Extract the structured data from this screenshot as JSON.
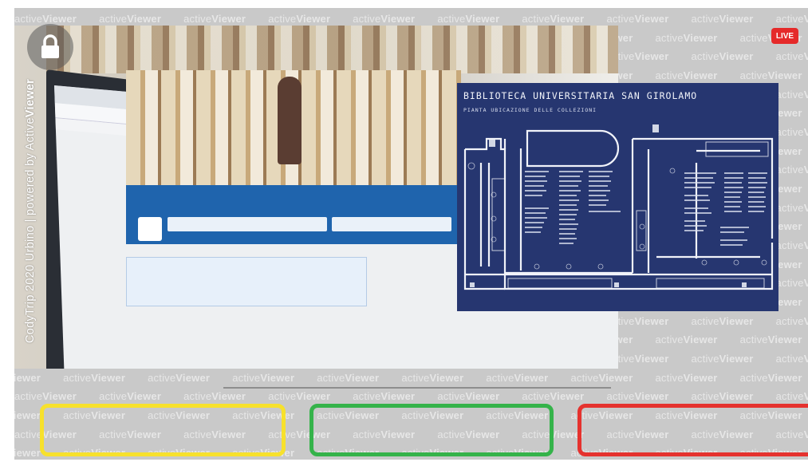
{
  "watermark": {
    "prefix": "active",
    "emphasis": "Viewer"
  },
  "credit": {
    "text": "CodyTrip 2020 Urbino | powered by Active",
    "emphasis": "Viewer"
  },
  "live_label": "LIVE",
  "map": {
    "title": "BIBLIOTECA UNIVERSITARIA SAN GIROLAMO",
    "subtitle": "PIANTA UBICAZIONE DELLE COLLEZIONI"
  },
  "icons": {
    "lock": "lock-icon"
  },
  "zones": [
    {
      "color": "#f7e12c",
      "name": "yellow"
    },
    {
      "color": "#35b34a",
      "name": "green"
    },
    {
      "color": "#e5322e",
      "name": "red"
    }
  ],
  "colors": {
    "map_background": "#263670",
    "live": "#e52a2a"
  }
}
